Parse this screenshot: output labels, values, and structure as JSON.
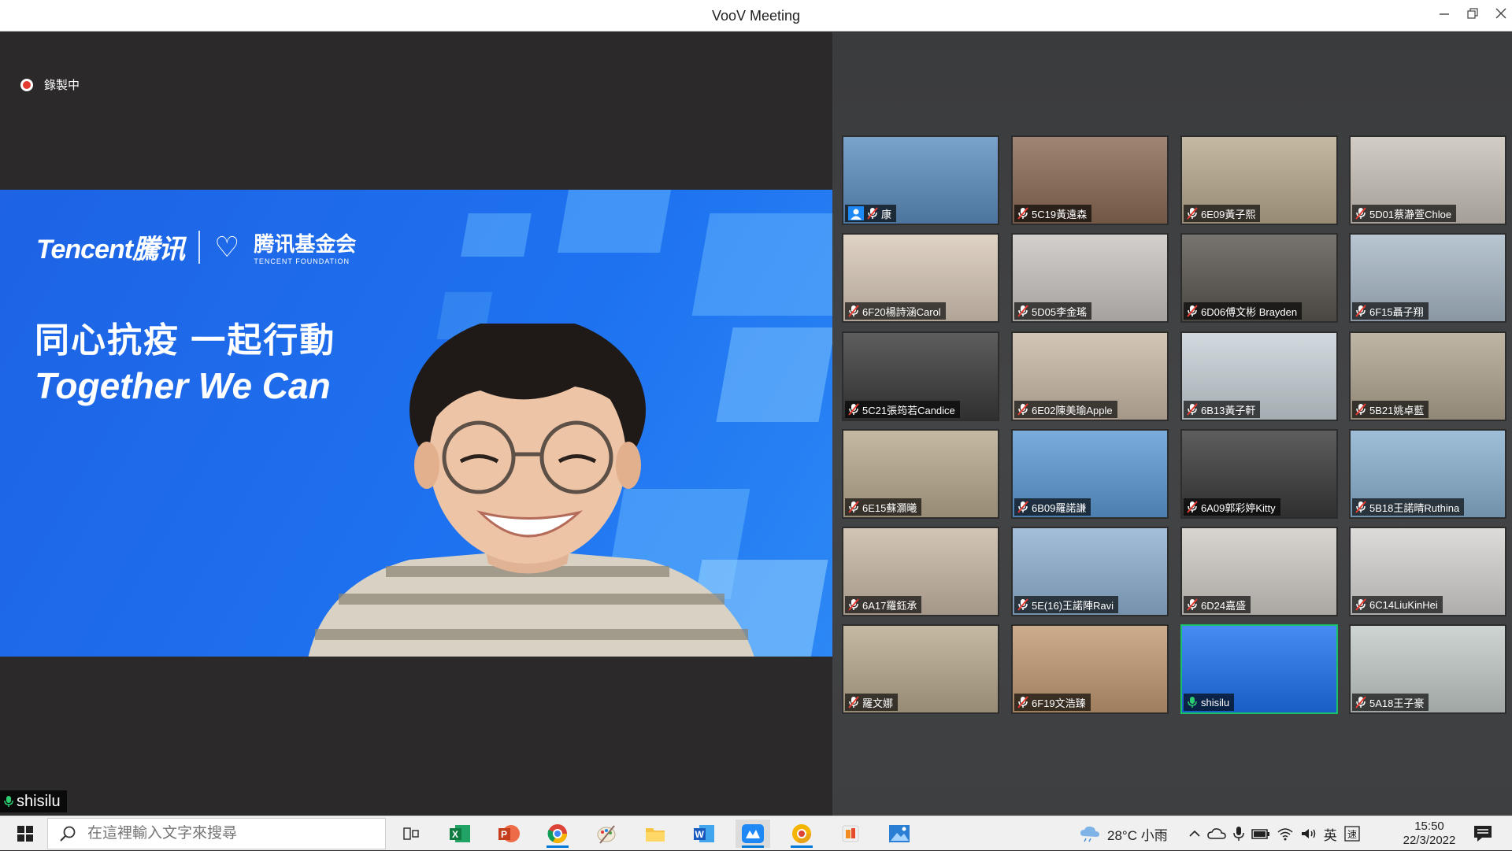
{
  "window": {
    "title": "VooV Meeting"
  },
  "recording": {
    "label": "錄製中"
  },
  "speaker": {
    "name": "shisilu",
    "slide": {
      "brand_tencent": "Tencent騰讯",
      "brand_foundation_cn": "腾讯基金会",
      "brand_foundation_en": "TENCENT FOUNDATION",
      "slogan_cn": "同心抗疫 一起行動",
      "slogan_en": "Together We Can"
    }
  },
  "participants": [
    {
      "name": "康",
      "bg": "#5d8ec0",
      "host": true
    },
    {
      "name": "5C19黃遠森",
      "bg": "#8a6a55"
    },
    {
      "name": "6E09黃子熙",
      "bg": "#b9a98f"
    },
    {
      "name": "5D01蔡瀞萱Chloe",
      "bg": "#c9c2b8"
    },
    {
      "name": "6F20楊詩涵Carol",
      "bg": "#d8c9b8"
    },
    {
      "name": "5D05李金瑤",
      "bg": "#c9c5c1"
    },
    {
      "name": "6D06傅文彬 Brayden",
      "bg": "#5a5550"
    },
    {
      "name": "6F15聶子翔",
      "bg": "#a9b9c8"
    },
    {
      "name": "5C21張筠若Candice",
      "bg": "#3a3a3a"
    },
    {
      "name": "6E02陳美瑜Apple",
      "bg": "#c9b9a7"
    },
    {
      "name": "6B13黃子軒",
      "bg": "#c8d2d8"
    },
    {
      "name": "5B21姚卓藍",
      "bg": "#b1a591"
    },
    {
      "name": "6E15蘇灝曦",
      "bg": "#b9a98f"
    },
    {
      "name": "6B09羅諾謙",
      "bg": "#5d9bd5"
    },
    {
      "name": "6A09郭彩婷Kitty",
      "bg": "#3a3a3a"
    },
    {
      "name": "5B18王諾晴Ruthina",
      "bg": "#8ab0d0"
    },
    {
      "name": "6A17羅鈺承",
      "bg": "#c8b8a6"
    },
    {
      "name": "5E(16)王諾陣Ravi",
      "bg": "#8fb1d2"
    },
    {
      "name": "6D24嘉盛",
      "bg": "#d0cbc5"
    },
    {
      "name": "6C14LiuKinHei",
      "bg": "#d6d4d2"
    },
    {
      "name": "羅文娜",
      "bg": "#b9a98f"
    },
    {
      "name": "6F19文浩臻",
      "bg": "#c29a73"
    },
    {
      "name": "shisilu",
      "bg": "#1e72f0",
      "active": true,
      "mic_on": true
    },
    {
      "name": "5A18王子豪",
      "bg": "#c3cbc9"
    }
  ],
  "taskbar": {
    "search_placeholder": "在這裡輸入文字來搜尋",
    "apps": [
      "task-view",
      "excel",
      "powerpoint",
      "chrome",
      "paint",
      "file-explorer",
      "word",
      "voov-meeting",
      "chrome-canary",
      "office",
      "photos"
    ],
    "weather": "28°C 小雨",
    "ime": "英",
    "clock_time": "15:50",
    "clock_date": "22/3/2022"
  }
}
